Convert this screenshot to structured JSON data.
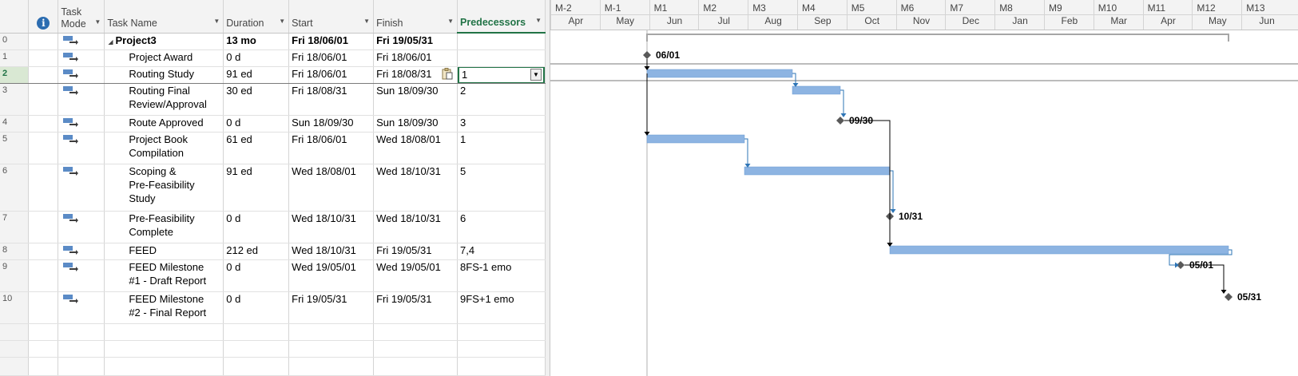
{
  "columns": {
    "task_mode": "Task\nMode",
    "task_name": "Task Name",
    "duration": "Duration",
    "start": "Start",
    "finish": "Finish",
    "predecessors": "Predecessors"
  },
  "rows": [
    {
      "id": "0",
      "name": "Project3",
      "duration": "13 mo",
      "start": "Fri 18/06/01",
      "finish": "Fri 19/05/31",
      "pred": "",
      "summary": true
    },
    {
      "id": "1",
      "name": "Project Award",
      "duration": "0 d",
      "start": "Fri 18/06/01",
      "finish": "Fri 18/06/01",
      "pred": ""
    },
    {
      "id": "2",
      "name": "Routing Study",
      "duration": "91 ed",
      "start": "Fri 18/06/01",
      "finish": "Fri 18/08/31",
      "pred": "1",
      "selected": true
    },
    {
      "id": "3",
      "name": "Routing Final\nReview/Approval",
      "duration": "30 ed",
      "start": "Fri 18/08/31",
      "finish": "Sun 18/09/30",
      "pred": "2"
    },
    {
      "id": "4",
      "name": "Route Approved",
      "duration": "0 d",
      "start": "Sun 18/09/30",
      "finish": "Sun 18/09/30",
      "pred": "3"
    },
    {
      "id": "5",
      "name": "Project Book\nCompilation",
      "duration": "61 ed",
      "start": "Fri 18/06/01",
      "finish": "Wed 18/08/01",
      "pred": "1"
    },
    {
      "id": "6",
      "name": "Scoping &\nPre-Feasibility\nStudy",
      "duration": "91 ed",
      "start": "Wed 18/08/01",
      "finish": "Wed 18/10/31",
      "pred": "5"
    },
    {
      "id": "7",
      "name": "Pre-Feasibility\nComplete",
      "duration": "0 d",
      "start": "Wed 18/10/31",
      "finish": "Wed 18/10/31",
      "pred": "6"
    },
    {
      "id": "8",
      "name": "FEED",
      "duration": "212 ed",
      "start": "Wed 18/10/31",
      "finish": "Fri 19/05/31",
      "pred": "7,4"
    },
    {
      "id": "9",
      "name": "FEED Milestone\n#1 - Draft Report",
      "duration": "0 d",
      "start": "Wed 19/05/01",
      "finish": "Wed 19/05/01",
      "pred": "8FS-1 emo"
    },
    {
      "id": "10",
      "name": "FEED Milestone\n#2 - Final Report",
      "duration": "0 d",
      "start": "Fri 19/05/31",
      "finish": "Fri 19/05/31",
      "pred": "9FS+1 emo"
    }
  ],
  "timescale": {
    "top": [
      "M-2",
      "M-1",
      "M1",
      "M2",
      "M3",
      "M4",
      "M5",
      "M6",
      "M7",
      "M8",
      "M9",
      "M10",
      "M11",
      "M12",
      "M13"
    ],
    "bottom": [
      "Apr",
      "May",
      "Jun",
      "Jul",
      "Aug",
      "Sep",
      "Oct",
      "Nov",
      "Dec",
      "Jan",
      "Feb",
      "Mar",
      "Apr",
      "May",
      "Jun"
    ]
  },
  "milestone_labels": {
    "r1": "06/01",
    "r4": "09/30",
    "r7": "10/31",
    "r9": "05/01",
    "r10": "05/31"
  },
  "colors": {
    "bar": "#8db4e2",
    "bar_border": "#6a9bd1",
    "link": "#2e75b6",
    "link_dark": "#000000",
    "milestone": "#595959",
    "accent": "#217346"
  },
  "chart_data": {
    "type": "gantt",
    "tasks": [
      {
        "id": 0,
        "name": "Project3",
        "start": "2018-06-01",
        "finish": "2019-05-31",
        "summary": true
      },
      {
        "id": 1,
        "name": "Project Award",
        "start": "2018-06-01",
        "finish": "2018-06-01",
        "milestone": true
      },
      {
        "id": 2,
        "name": "Routing Study",
        "start": "2018-06-01",
        "finish": "2018-08-31"
      },
      {
        "id": 3,
        "name": "Routing Final Review/Approval",
        "start": "2018-08-31",
        "finish": "2018-09-30"
      },
      {
        "id": 4,
        "name": "Route Approved",
        "start": "2018-09-30",
        "finish": "2018-09-30",
        "milestone": true
      },
      {
        "id": 5,
        "name": "Project Book Compilation",
        "start": "2018-06-01",
        "finish": "2018-08-01"
      },
      {
        "id": 6,
        "name": "Scoping & Pre-Feasibility Study",
        "start": "2018-08-01",
        "finish": "2018-10-31"
      },
      {
        "id": 7,
        "name": "Pre-Feasibility Complete",
        "start": "2018-10-31",
        "finish": "2018-10-31",
        "milestone": true
      },
      {
        "id": 8,
        "name": "FEED",
        "start": "2018-10-31",
        "finish": "2019-05-31"
      },
      {
        "id": 9,
        "name": "FEED Milestone #1 - Draft Report",
        "start": "2019-05-01",
        "finish": "2019-05-01",
        "milestone": true
      },
      {
        "id": 10,
        "name": "FEED Milestone #2 - Final Report",
        "start": "2019-05-31",
        "finish": "2019-05-31",
        "milestone": true
      }
    ]
  }
}
